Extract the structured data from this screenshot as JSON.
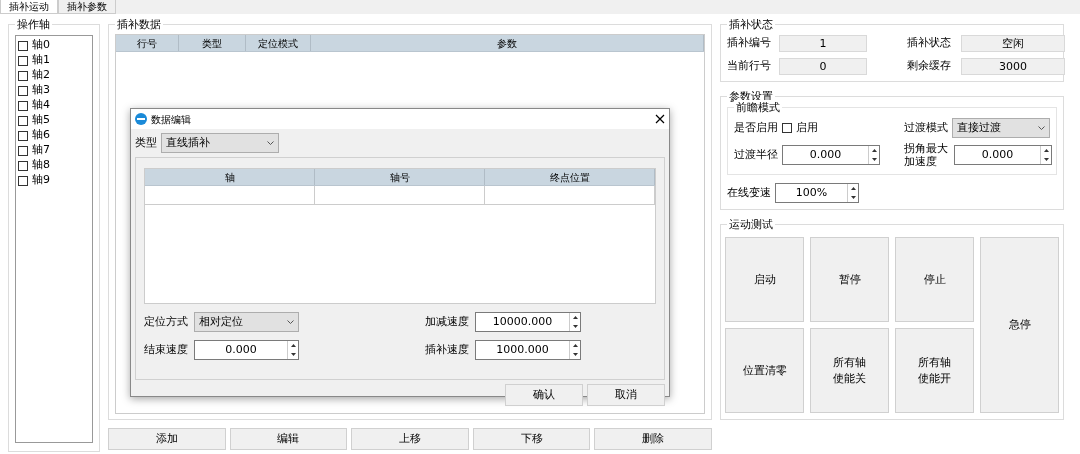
{
  "tabs": [
    {
      "label": "插补运动",
      "selected": true
    },
    {
      "label": "插补参数",
      "selected": false
    }
  ],
  "axes_panel": {
    "title": "操作轴",
    "axes": [
      {
        "label": "轴0",
        "checked": false
      },
      {
        "label": "轴1",
        "checked": false
      },
      {
        "label": "轴2",
        "checked": false
      },
      {
        "label": "轴3",
        "checked": false
      },
      {
        "label": "轴4",
        "checked": false
      },
      {
        "label": "轴5",
        "checked": false
      },
      {
        "label": "轴6",
        "checked": false
      },
      {
        "label": "轴7",
        "checked": false
      },
      {
        "label": "轴8",
        "checked": false
      },
      {
        "label": "轴9",
        "checked": false
      }
    ]
  },
  "data_panel": {
    "title": "插补数据",
    "table": {
      "columns": [
        "行号",
        "类型",
        "定位模式",
        "参数"
      ]
    },
    "buttons": [
      "添加",
      "编辑",
      "上移",
      "下移",
      "删除"
    ]
  },
  "dialog": {
    "title": "数据编辑",
    "type_label": "类型",
    "type_value": "直线插补",
    "table": {
      "columns": [
        "轴",
        "轴号",
        "终点位置"
      ]
    },
    "fields": [
      {
        "label": "定位方式",
        "kind": "select",
        "value": "相对定位"
      },
      {
        "label": "加减速度",
        "kind": "spin",
        "value": "10000.000"
      },
      {
        "label": "结束速度",
        "kind": "spin",
        "value": "0.000"
      },
      {
        "label": "插补速度",
        "kind": "spin",
        "value": "1000.000"
      }
    ],
    "buttons": [
      "确认",
      "取消"
    ]
  },
  "status_panel": {
    "title": "插补状态",
    "items": [
      {
        "label": "插补编号",
        "value": "1"
      },
      {
        "label": "插补状态",
        "value": "空闲"
      },
      {
        "label": "当前行号",
        "value": "0"
      },
      {
        "label": "剩余缓存",
        "value": "3000"
      }
    ]
  },
  "params_panel": {
    "title": "参数设置",
    "lookahead": {
      "title": "前瞻模式",
      "enable_label": "是否启用",
      "enable_checkbox": {
        "label": "启用",
        "checked": false
      },
      "transition_mode": {
        "label": "过渡模式",
        "value": "直接过渡"
      },
      "transition_radius": {
        "label": "过渡半径",
        "value": "0.000"
      },
      "corner_accel": {
        "label": "拐角最大加速度",
        "value": "0.000"
      }
    },
    "online_speed": {
      "label": "在线变速",
      "value": "100%"
    }
  },
  "test_panel": {
    "title": "运动测试",
    "buttons": [
      {
        "label": "启动",
        "kind": "normal"
      },
      {
        "label": "暂停",
        "kind": "normal"
      },
      {
        "label": "停止",
        "kind": "normal"
      },
      {
        "label": "急停",
        "kind": "tall"
      },
      {
        "label": "位置清零",
        "kind": "normal"
      },
      {
        "label": "所有轴使能关",
        "kind": "wrap"
      },
      {
        "label": "所有轴使能开",
        "kind": "wrap"
      }
    ]
  }
}
